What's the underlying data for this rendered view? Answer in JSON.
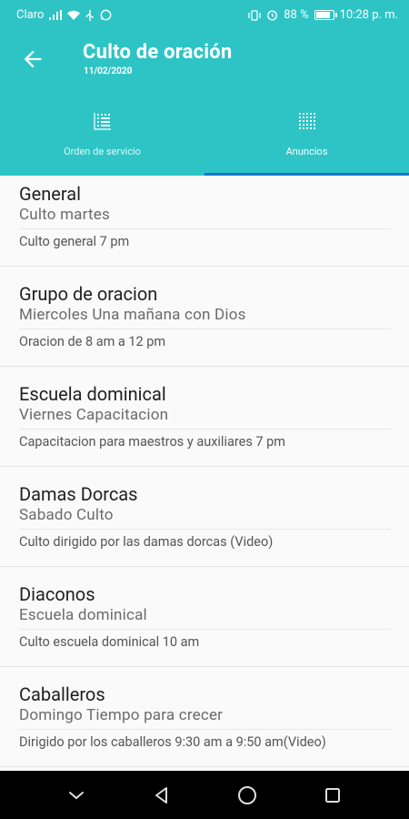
{
  "status": {
    "carrier": "Claro",
    "battery_pct": "88 %",
    "battery_level": 0.88,
    "time": "10:28 p. m."
  },
  "header": {
    "title": "Culto de oración",
    "date": "11/02/2020"
  },
  "tabs": [
    {
      "label": "Orden de servicio",
      "icon": "list-grid-icon"
    },
    {
      "label": "Anuncios",
      "icon": "dot-grid-icon",
      "selected": true
    }
  ],
  "items": [
    {
      "title": "General",
      "subtitle": "Culto martes",
      "description": "Culto general 7 pm"
    },
    {
      "title": "Grupo de oracion",
      "subtitle": "Miercoles Una mañana con Dios",
      "description": "Oracion de 8 am a 12 pm"
    },
    {
      "title": "Escuela dominical",
      "subtitle": "Viernes Capacitacion",
      "description": "Capacitacion para maestros y auxiliares 7 pm"
    },
    {
      "title": "Damas Dorcas",
      "subtitle": "Sabado Culto",
      "description": "Culto dirigido por las damas dorcas (Video)"
    },
    {
      "title": "Diaconos",
      "subtitle": "Escuela dominical",
      "description": "Culto escuela dominical 10 am"
    },
    {
      "title": "Caballeros",
      "subtitle": "Domingo Tiempo para crecer",
      "description": "Dirigido por los caballeros 9:30 am a 9:50 am(Video)"
    }
  ],
  "colors": {
    "primary": "#2ec4c6",
    "tab_indicator": "#1976d2",
    "navbar": "#000000"
  }
}
